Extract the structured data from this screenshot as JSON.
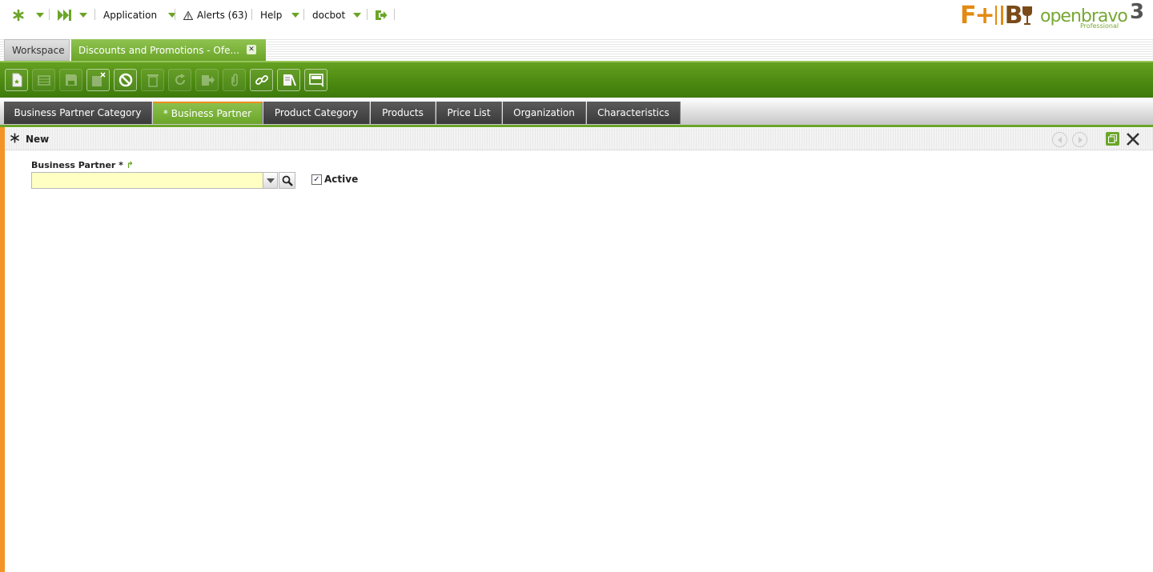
{
  "topnav": {
    "application_label": "Application",
    "alerts_label": "Alerts (63)",
    "help_label": "Help",
    "user_label": "docbot"
  },
  "logos": {
    "fyb_text_f": "F+",
    "fyb_text_b": "B",
    "openbravo_word": "openbravo",
    "openbravo_version": "3",
    "openbravo_edition": "Professional"
  },
  "window_tabs": [
    {
      "label": "Workspace"
    },
    {
      "label": "Discounts and Promotions - Ofe..."
    }
  ],
  "toolbar": {
    "buttons": [
      "new-document",
      "new-row",
      "save",
      "save-close",
      "undo",
      "delete",
      "refresh",
      "export",
      "attachments",
      "link",
      "audit",
      "grid-view"
    ]
  },
  "subtabs": [
    {
      "label": "Business Partner Category"
    },
    {
      "label": "* Business Partner"
    },
    {
      "label": "Product Category"
    },
    {
      "label": "Products"
    },
    {
      "label": "Price List"
    },
    {
      "label": "Organization"
    },
    {
      "label": "Characteristics"
    }
  ],
  "form": {
    "header_title": "New",
    "business_partner_label": "Business Partner *",
    "business_partner_value": "",
    "active_label": "Active",
    "active_checked": true
  },
  "colors": {
    "accent_green": "#6ba529",
    "toolbar_green": "#4c8a11",
    "orange": "#f39427",
    "input_required": "#ffffc4"
  }
}
